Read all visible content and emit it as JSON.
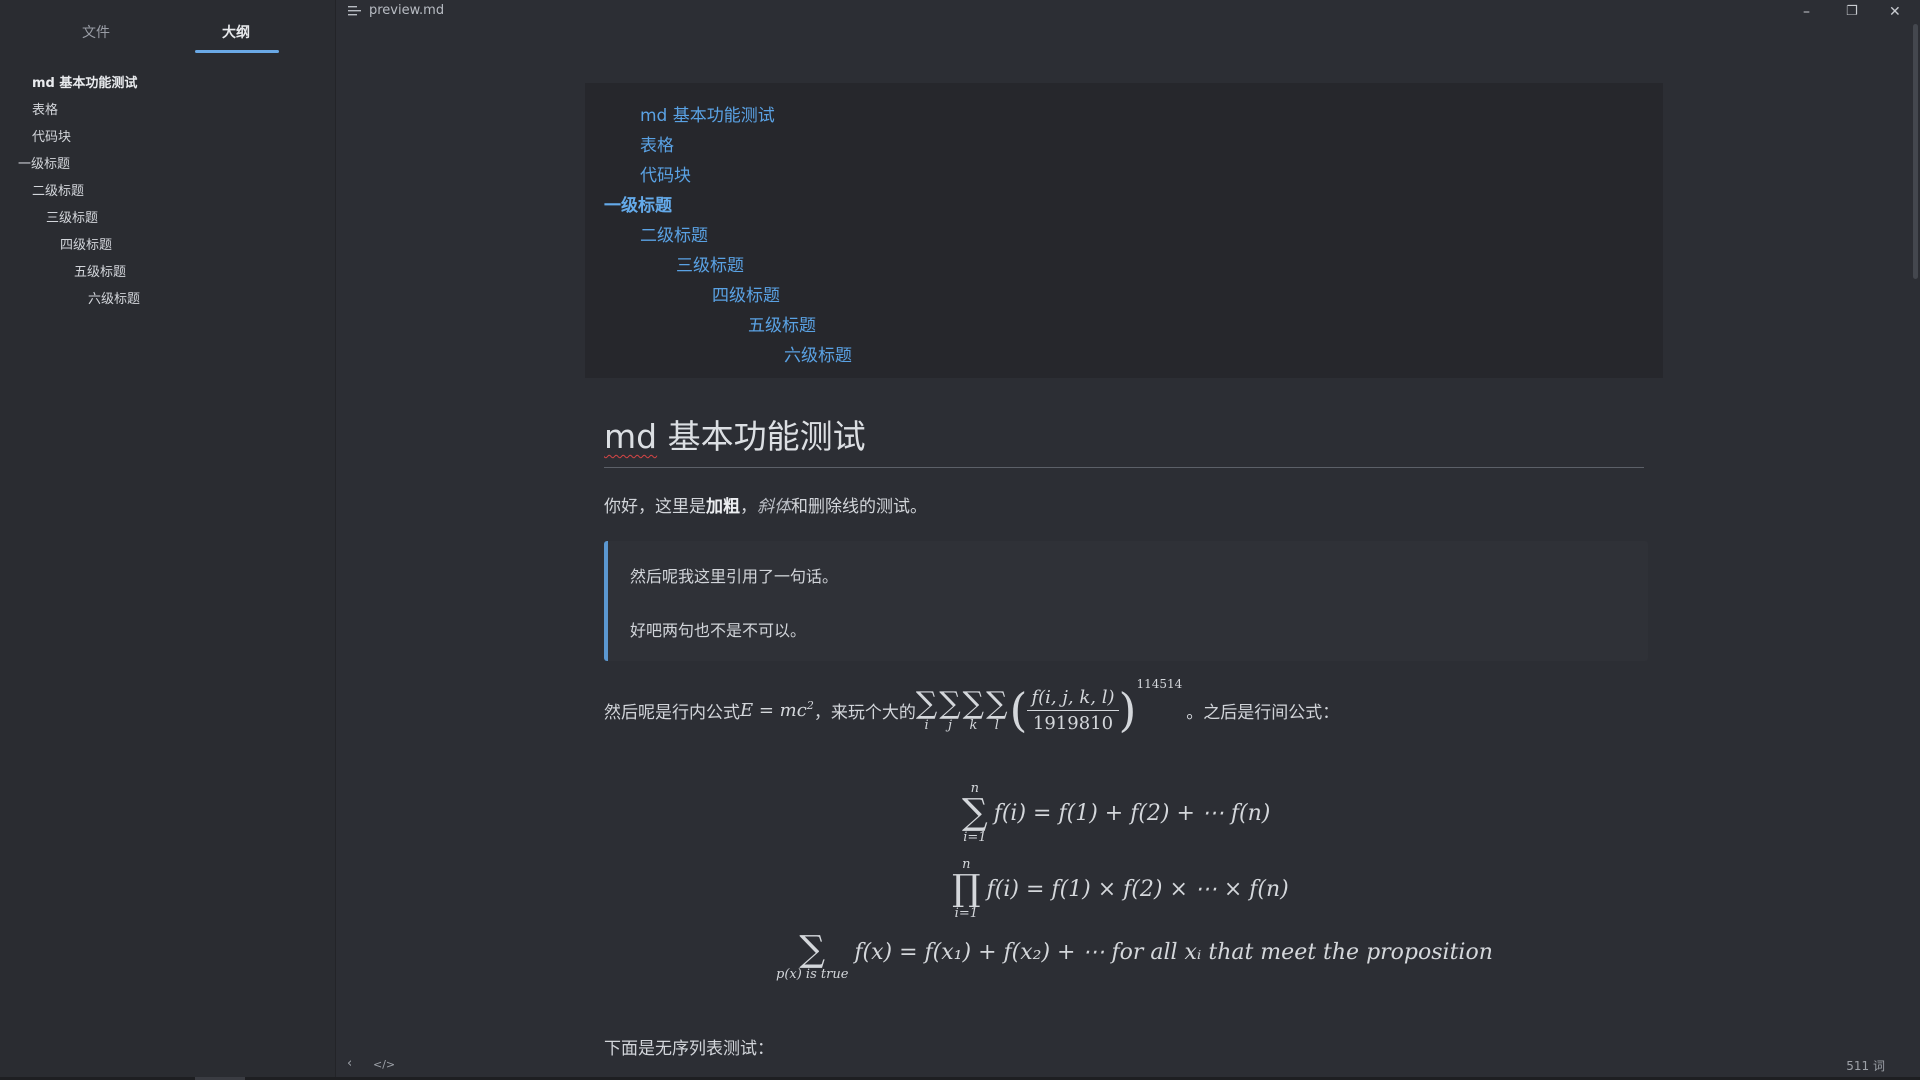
{
  "window": {
    "title": "preview.md",
    "minimize": "–",
    "restore": "❐",
    "close": "✕"
  },
  "sidebar": {
    "tabs": [
      "文件",
      "大纲"
    ],
    "active_tab": "大纲",
    "outline": [
      "md 基本功能测试",
      "表格",
      "代码块",
      "一级标题",
      "二级标题",
      "三级标题",
      "四级标题",
      "五级标题",
      "六级标题"
    ]
  },
  "toc": [
    "md 基本功能测试",
    "表格",
    "代码块",
    "一级标题",
    "二级标题",
    "三级标题",
    "四级标题",
    "五级标题",
    "六级标题"
  ],
  "content": {
    "h1_prefix": "md",
    "h1_rest": " 基本功能测试",
    "p1": {
      "lead": "你好，这里是",
      "bold": "加粗",
      "sep": "，",
      "italic": "斜体",
      "tail": "和删除线的测试。"
    },
    "quote": [
      "然后呢我这里引用了一句话。",
      "好吧两句也不是不可以。"
    ],
    "p2": {
      "lead": "然后呢是行内公式 ",
      "formula": "E = mc",
      "formula_exp": "2",
      "mid": "，来玩个大的 ",
      "frac_num": "f(i, j, k, l)",
      "frac_den": "1919810",
      "power": "114514",
      "sum_indices": [
        "i",
        "j",
        "k",
        "l"
      ],
      "tail": "。之后是行间公式："
    },
    "eq1": {
      "upper": "n",
      "lower": "i=1",
      "body": "f(i) = f(1) + f(2) + ⋯ f(n)"
    },
    "eq2": {
      "upper": "n",
      "lower": "i=1",
      "body": "f(i) = f(1) × f(2) × ⋯ × f(n)"
    },
    "eq3": {
      "lower": "p(x) is true",
      "body": "f(x) = f(x₁) + f(x₂) + ⋯ for all xᵢ that meet the proposition"
    },
    "p3": "下面是无序列表测试："
  },
  "status": {
    "back": "‹",
    "source": "</>",
    "word_count": "511 词"
  }
}
